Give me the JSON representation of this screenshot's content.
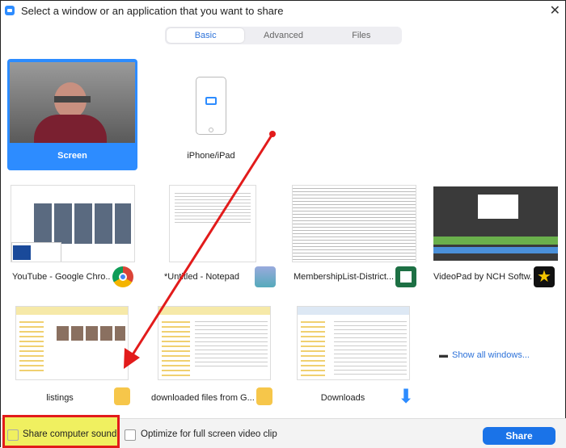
{
  "title": "Select a window or an application that you want to share",
  "tabs": [
    {
      "label": "Basic",
      "active": true
    },
    {
      "label": "Advanced"
    },
    {
      "label": "Files"
    }
  ],
  "tiles": [
    {
      "label": "Screen",
      "selected": true
    },
    {
      "label": "iPhone/iPad"
    },
    {
      "label": "YouTube - Google Chro..."
    },
    {
      "label": "*Untitled - Notepad"
    },
    {
      "label": "MembershipList-District..."
    },
    {
      "label": "VideoPad by NCH Softw..."
    },
    {
      "label": "listings"
    },
    {
      "label": "downloaded files from G..."
    },
    {
      "label": "Downloads"
    }
  ],
  "show_all": "Show all windows...",
  "footer": {
    "share_sound": "Share computer sound",
    "optimize": "Optimize for full screen video clip",
    "share": "Share"
  },
  "colors": {
    "accent": "#2d8cff",
    "highlight": "#f0f060",
    "annotation": "#e21b1b"
  }
}
